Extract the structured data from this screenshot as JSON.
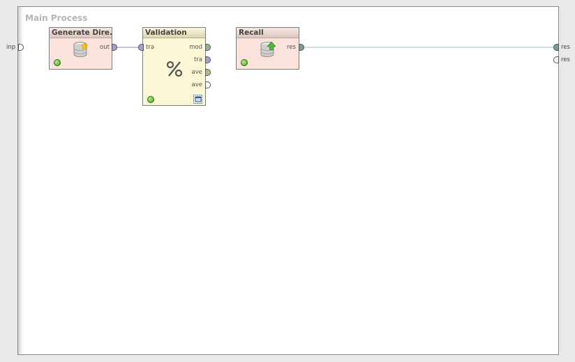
{
  "process": {
    "title": "Main Process"
  },
  "colors": {
    "example_set_port": "#7a9c9c",
    "model_port": "#8fb58f",
    "data_port": "#a99ccf",
    "performance_port": "#bdb88a",
    "empty_port": "#ffffff",
    "connection_line": "#8fc7c7",
    "connection_line_data": "#8b82c6"
  },
  "external_ports": {
    "left": [
      {
        "label": "inp",
        "color": "empty"
      }
    ],
    "right": [
      {
        "label": "res",
        "color": "example_set"
      },
      {
        "label": "res",
        "color": "empty"
      }
    ]
  },
  "operators": [
    {
      "name": "Generate Dire...",
      "icon": "database-star-icon",
      "inputs": [],
      "outputs": [
        {
          "label": "out",
          "color": "data"
        }
      ]
    },
    {
      "name": "Validation",
      "icon": "percent-icon",
      "subprocess_icon": "subprocess-windows-icon",
      "inputs": [
        {
          "label": "tra",
          "color": "data"
        }
      ],
      "outputs": [
        {
          "label": "mod",
          "color": "model"
        },
        {
          "label": "tra",
          "color": "data"
        },
        {
          "label": "ave",
          "color": "performance"
        },
        {
          "label": "ave",
          "color": "empty"
        }
      ]
    },
    {
      "name": "Recall",
      "icon": "database-upload-icon",
      "inputs": [],
      "outputs": [
        {
          "label": "res",
          "color": "example_set"
        }
      ]
    }
  ]
}
